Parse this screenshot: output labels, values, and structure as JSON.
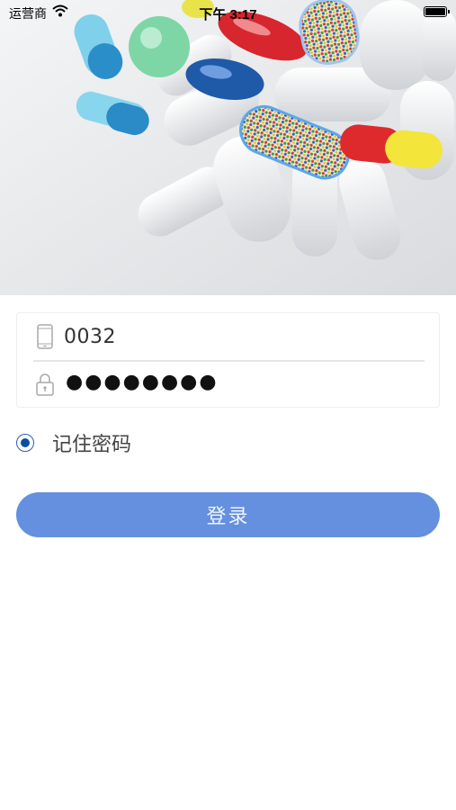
{
  "status_bar": {
    "carrier": "运营商",
    "time": "下午 3:17"
  },
  "login": {
    "account_value": "0032",
    "password_mask": "●●●●●●●●",
    "remember_label": "记住密码",
    "remember_checked": true,
    "submit_label": "登录"
  },
  "icons": {
    "account": "phone-icon",
    "password": "lock-icon",
    "wifi": "wifi-icon",
    "battery": "battery-icon"
  },
  "colors": {
    "primary_button": "#6490df",
    "radio_accent": "#0b4fa0"
  }
}
